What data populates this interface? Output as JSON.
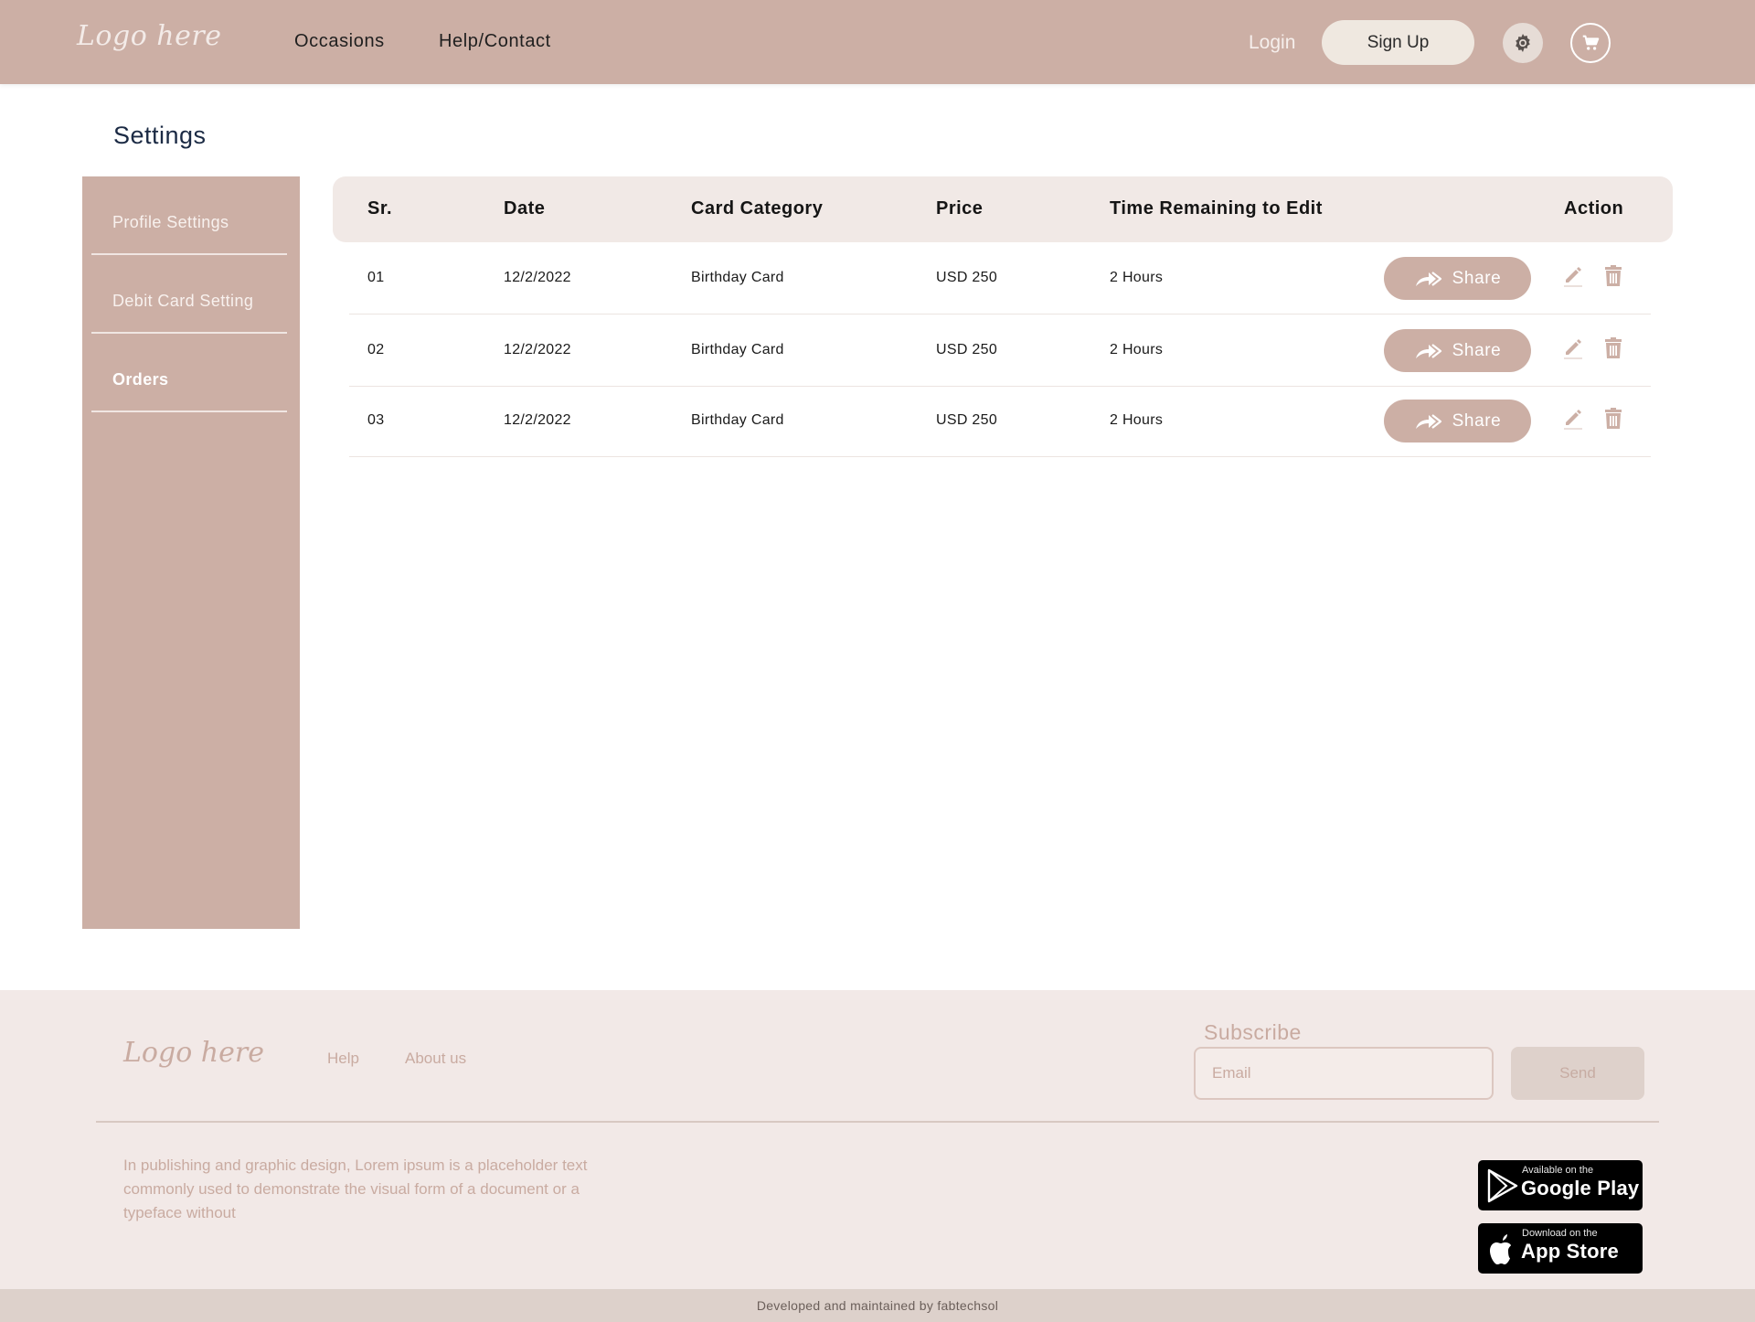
{
  "header": {
    "logo": "Logo here",
    "nav": [
      "Occasions",
      "Help/Contact"
    ],
    "login": "Login",
    "signup": "Sign Up",
    "icons": [
      "settings-icon",
      "cart-icon"
    ]
  },
  "page_title": "Settings",
  "sidebar": {
    "items": [
      {
        "label": "Profile Settings",
        "active": false
      },
      {
        "label": "Debit Card Setting",
        "active": false
      },
      {
        "label": "Orders",
        "active": true
      }
    ]
  },
  "table": {
    "headers": [
      "Sr.",
      "Date",
      "Card Category",
      "Price",
      "Time Remaining to Edit",
      "Action"
    ],
    "share_label": "Share",
    "rows": [
      {
        "sr": "01",
        "date": "12/2/2022",
        "category": "Birthday Card",
        "price": "USD 250",
        "time": "2 Hours"
      },
      {
        "sr": "02",
        "date": "12/2/2022",
        "category": "Birthday Card",
        "price": "USD 250",
        "time": "2 Hours"
      },
      {
        "sr": "03",
        "date": "12/2/2022",
        "category": "Birthday Card",
        "price": "USD 250",
        "time": "2 Hours"
      }
    ]
  },
  "footer": {
    "logo": "Logo here",
    "links": [
      "Help",
      "About us"
    ],
    "subscribe_title": "Subscribe",
    "email_placeholder": "Email",
    "send_label": "Send",
    "description": "In publishing and graphic design, Lorem ipsum is a placeholder text commonly used to demonstrate the visual form of a document or a typeface without",
    "google_play": {
      "small": "Available on the",
      "big": "Google Play"
    },
    "app_store": {
      "small": "Download on the",
      "big": "App Store"
    },
    "credit": "Developed and maintained by fabtechsol"
  },
  "colors": {
    "brand": "#ccafa5",
    "footer_bg": "#f2e9e7",
    "table_header_bg": "#f1e9e6"
  }
}
